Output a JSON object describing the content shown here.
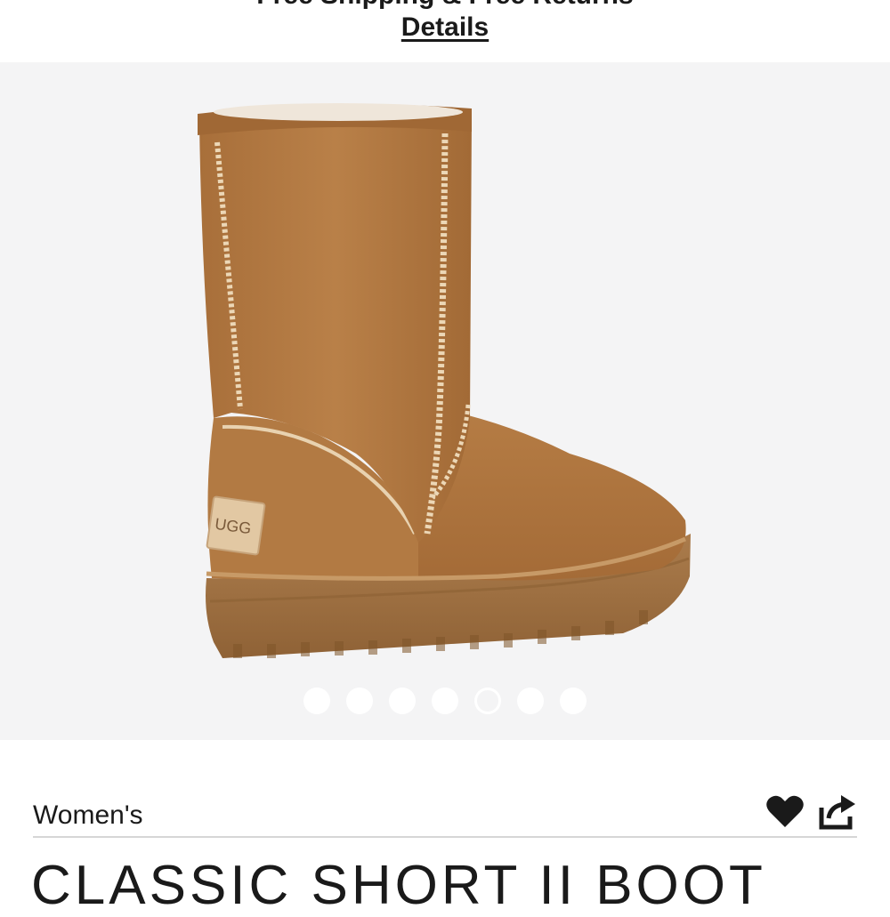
{
  "promo": {
    "partial_text": "Free Shipping & Free Returns",
    "details_label": "Details"
  },
  "gallery": {
    "image_label": "UGG",
    "image_count": 7,
    "active_index": 4
  },
  "product": {
    "category": "Women's",
    "title": "CLASSIC SHORT II BOOT"
  },
  "icons": {
    "favorite": "heart-icon",
    "share": "share-icon"
  },
  "colors": {
    "text": "#1a1a1a",
    "gallery_bg": "#f4f4f5",
    "boot": "#b27a43",
    "sole": "#a77848"
  }
}
